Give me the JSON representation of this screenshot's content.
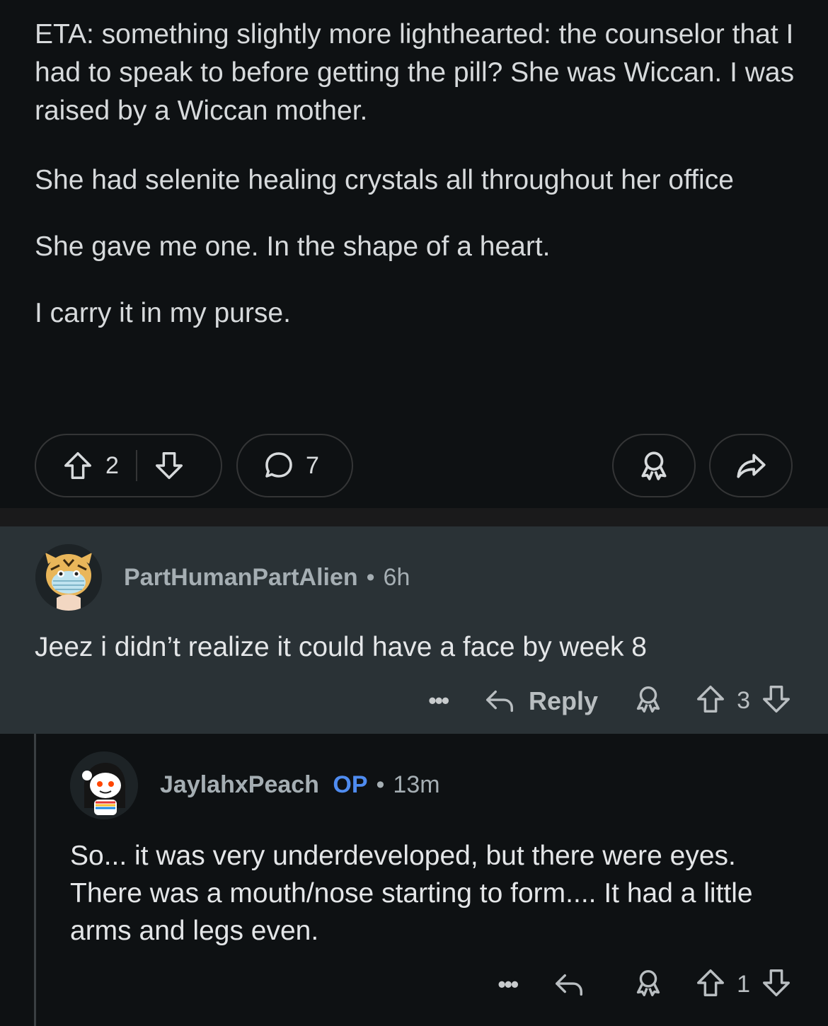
{
  "post": {
    "paragraphs": [
      "ETA: something slightly more lighthearted: the counselor that I had to speak to before getting the pill? She was Wiccan. I was raised by a Wiccan mother.",
      "She had selenite healing crystals all throughout her office",
      "She gave me one. In the shape of a heart.",
      "I carry it in my purse."
    ],
    "upvotes": "2",
    "comments": "7"
  },
  "comments": [
    {
      "username": "PartHumanPartAlien",
      "separator": "•",
      "time": "6h",
      "body": "Jeez i didn’t realize it could have a face by week 8",
      "more": "•••",
      "reply_label": "Reply",
      "votes": "3"
    },
    {
      "username": "JaylahxPeach",
      "badge": "OP",
      "separator": "•",
      "time": "13m",
      "body": "So... it was very underdeveloped, but there were eyes. There was a mouth/nose starting to form.... It had a little arms and legs even.",
      "more": "•••",
      "votes": "1"
    }
  ],
  "colors": {
    "background": "#0e1113",
    "highlight_comment": "#2a3236",
    "op_badge": "#4f8cf0"
  },
  "icons": [
    "upvote-icon",
    "downvote-icon",
    "comment-icon",
    "award-icon",
    "share-icon",
    "reply-icon",
    "more-icon"
  ]
}
